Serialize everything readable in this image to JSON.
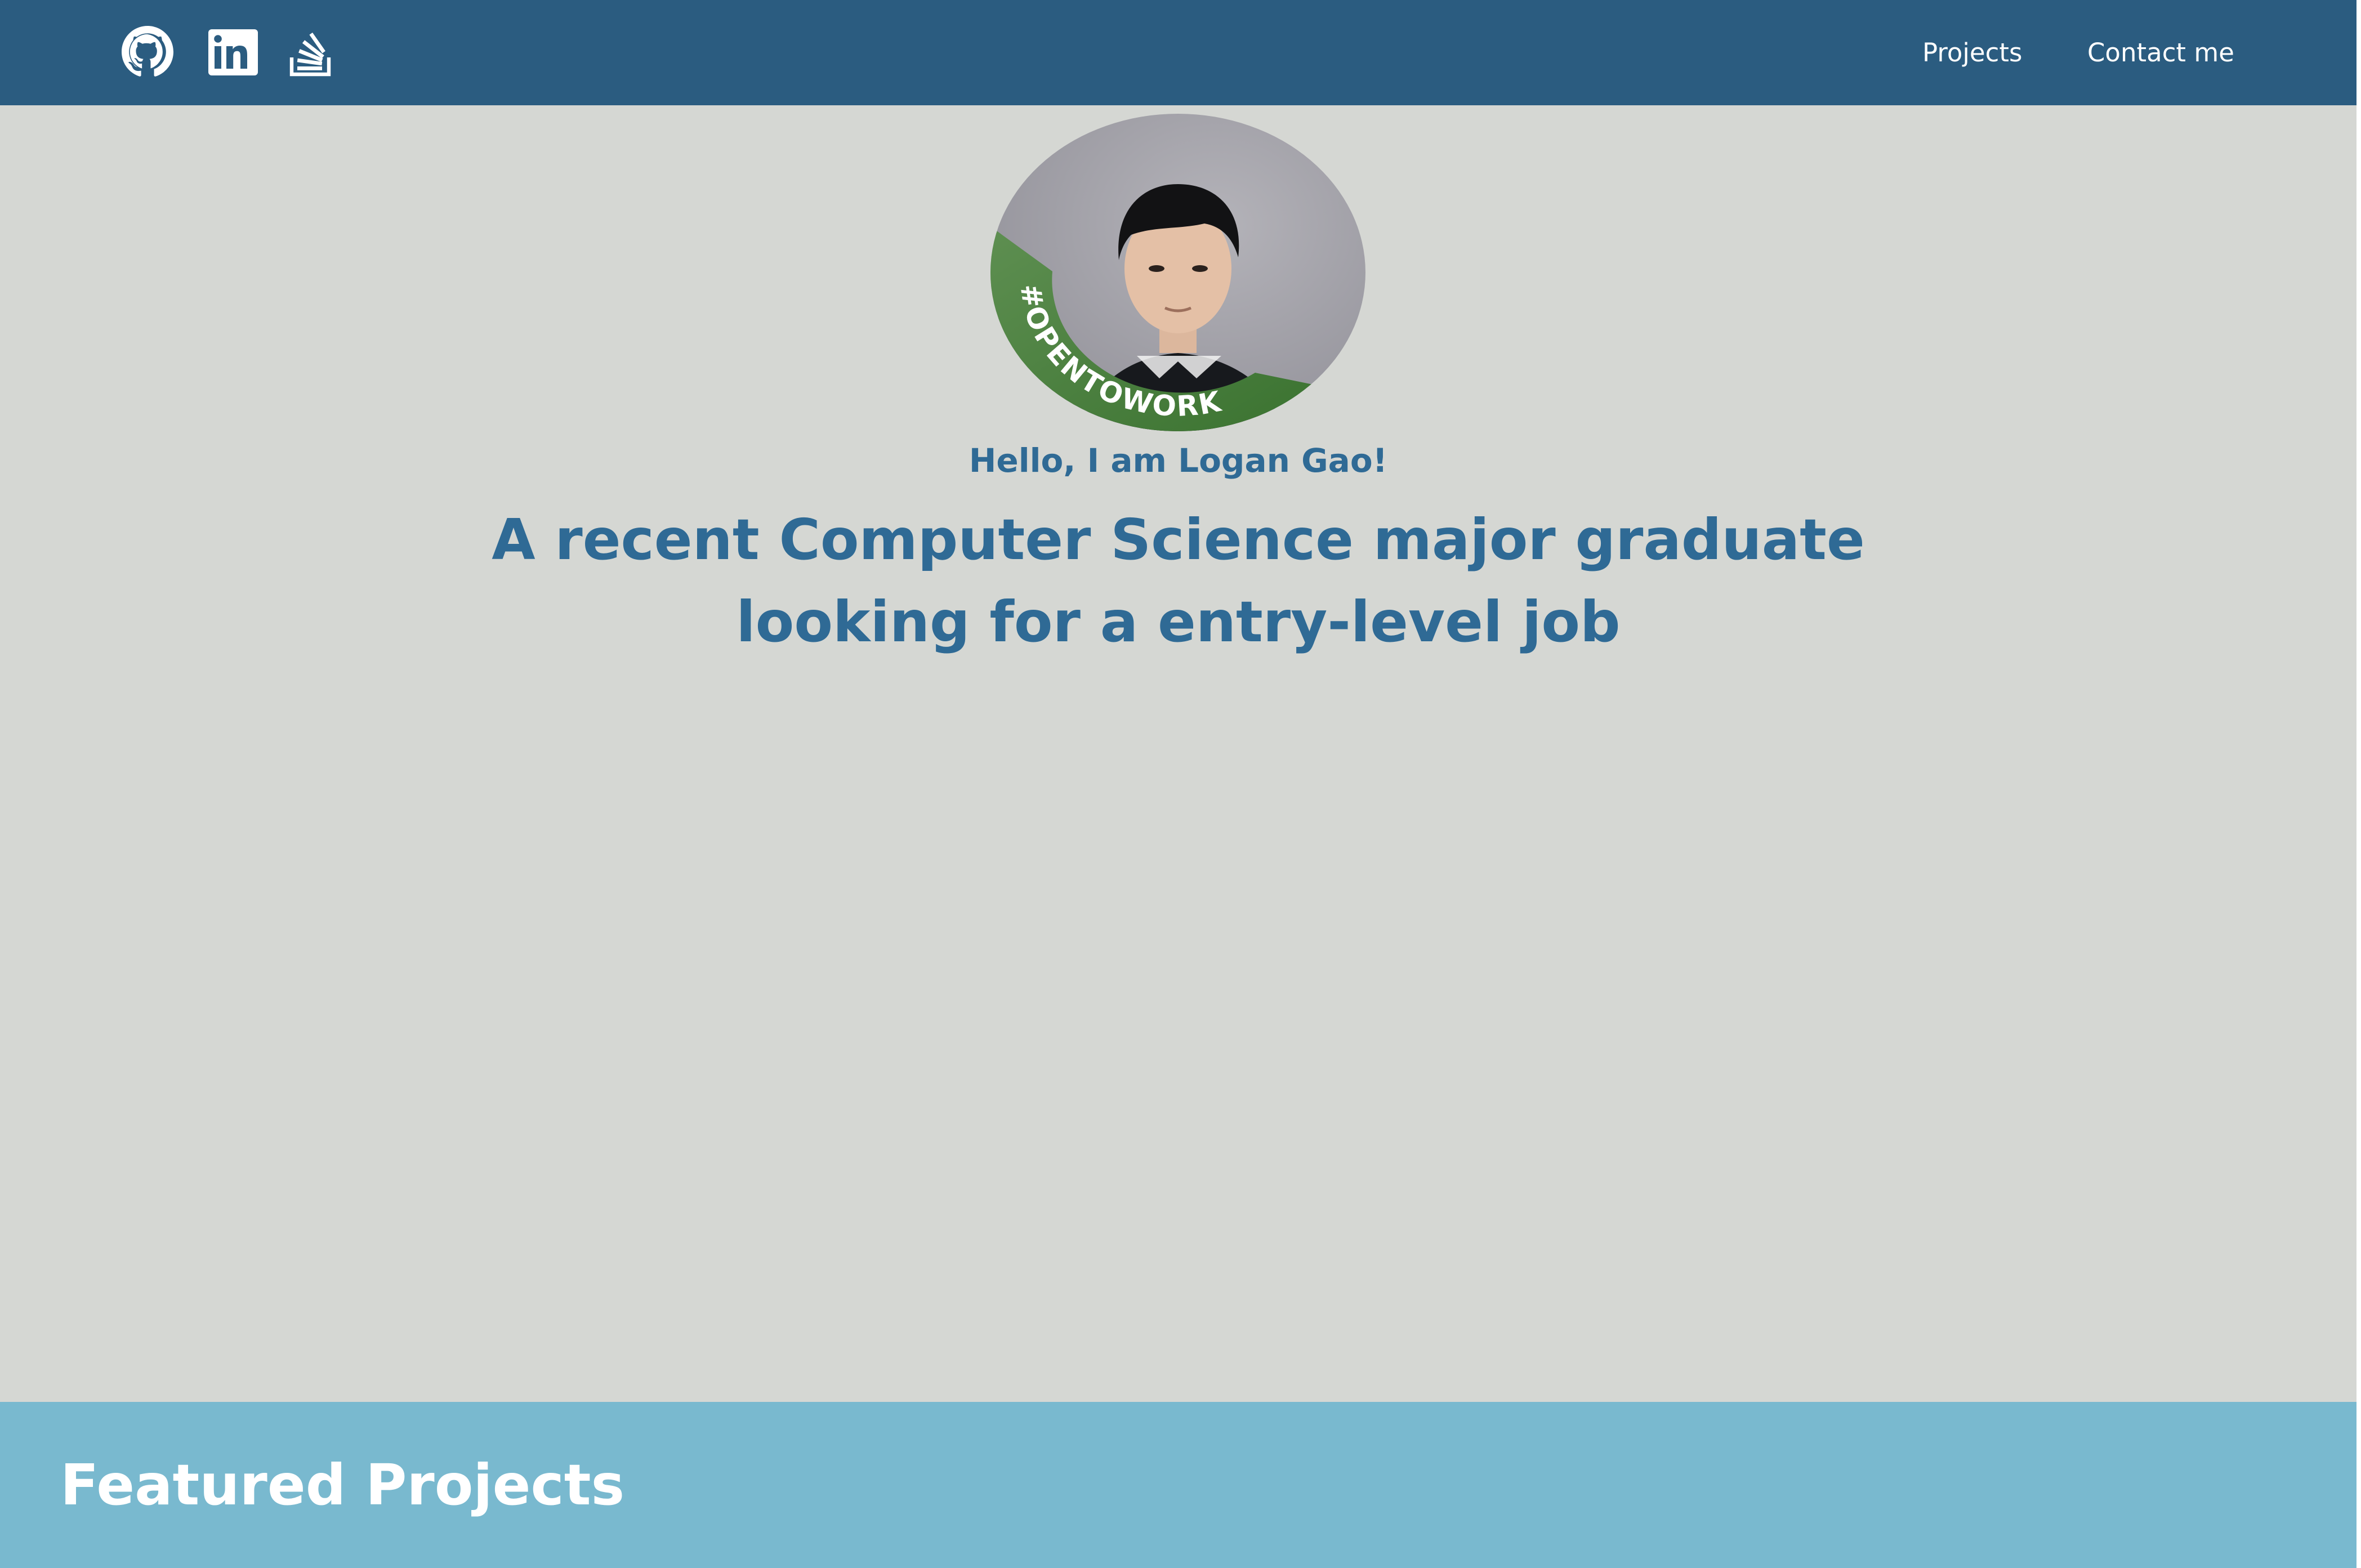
{
  "header": {
    "social": [
      {
        "icon": "github-icon"
      },
      {
        "icon": "linkedin-icon"
      },
      {
        "icon": "stackoverflow-icon"
      }
    ],
    "nav": {
      "projects_label": "Projects",
      "contact_label": "Contact me"
    }
  },
  "hero": {
    "avatar_badge": "#OPENTOWORK",
    "greeting": "Hello, I am Logan Gao!",
    "headline_line1": "A recent Computer Science major graduate",
    "headline_line2": "looking for a entry-level job"
  },
  "featured": {
    "title": "Featured Projects"
  },
  "colors": {
    "topbar": "#2b5c80",
    "hero_bg": "#d5d7d3",
    "accent_text": "#2f6a95",
    "featured_bg": "#79b9cf",
    "badge_green": "#3f7a34"
  }
}
